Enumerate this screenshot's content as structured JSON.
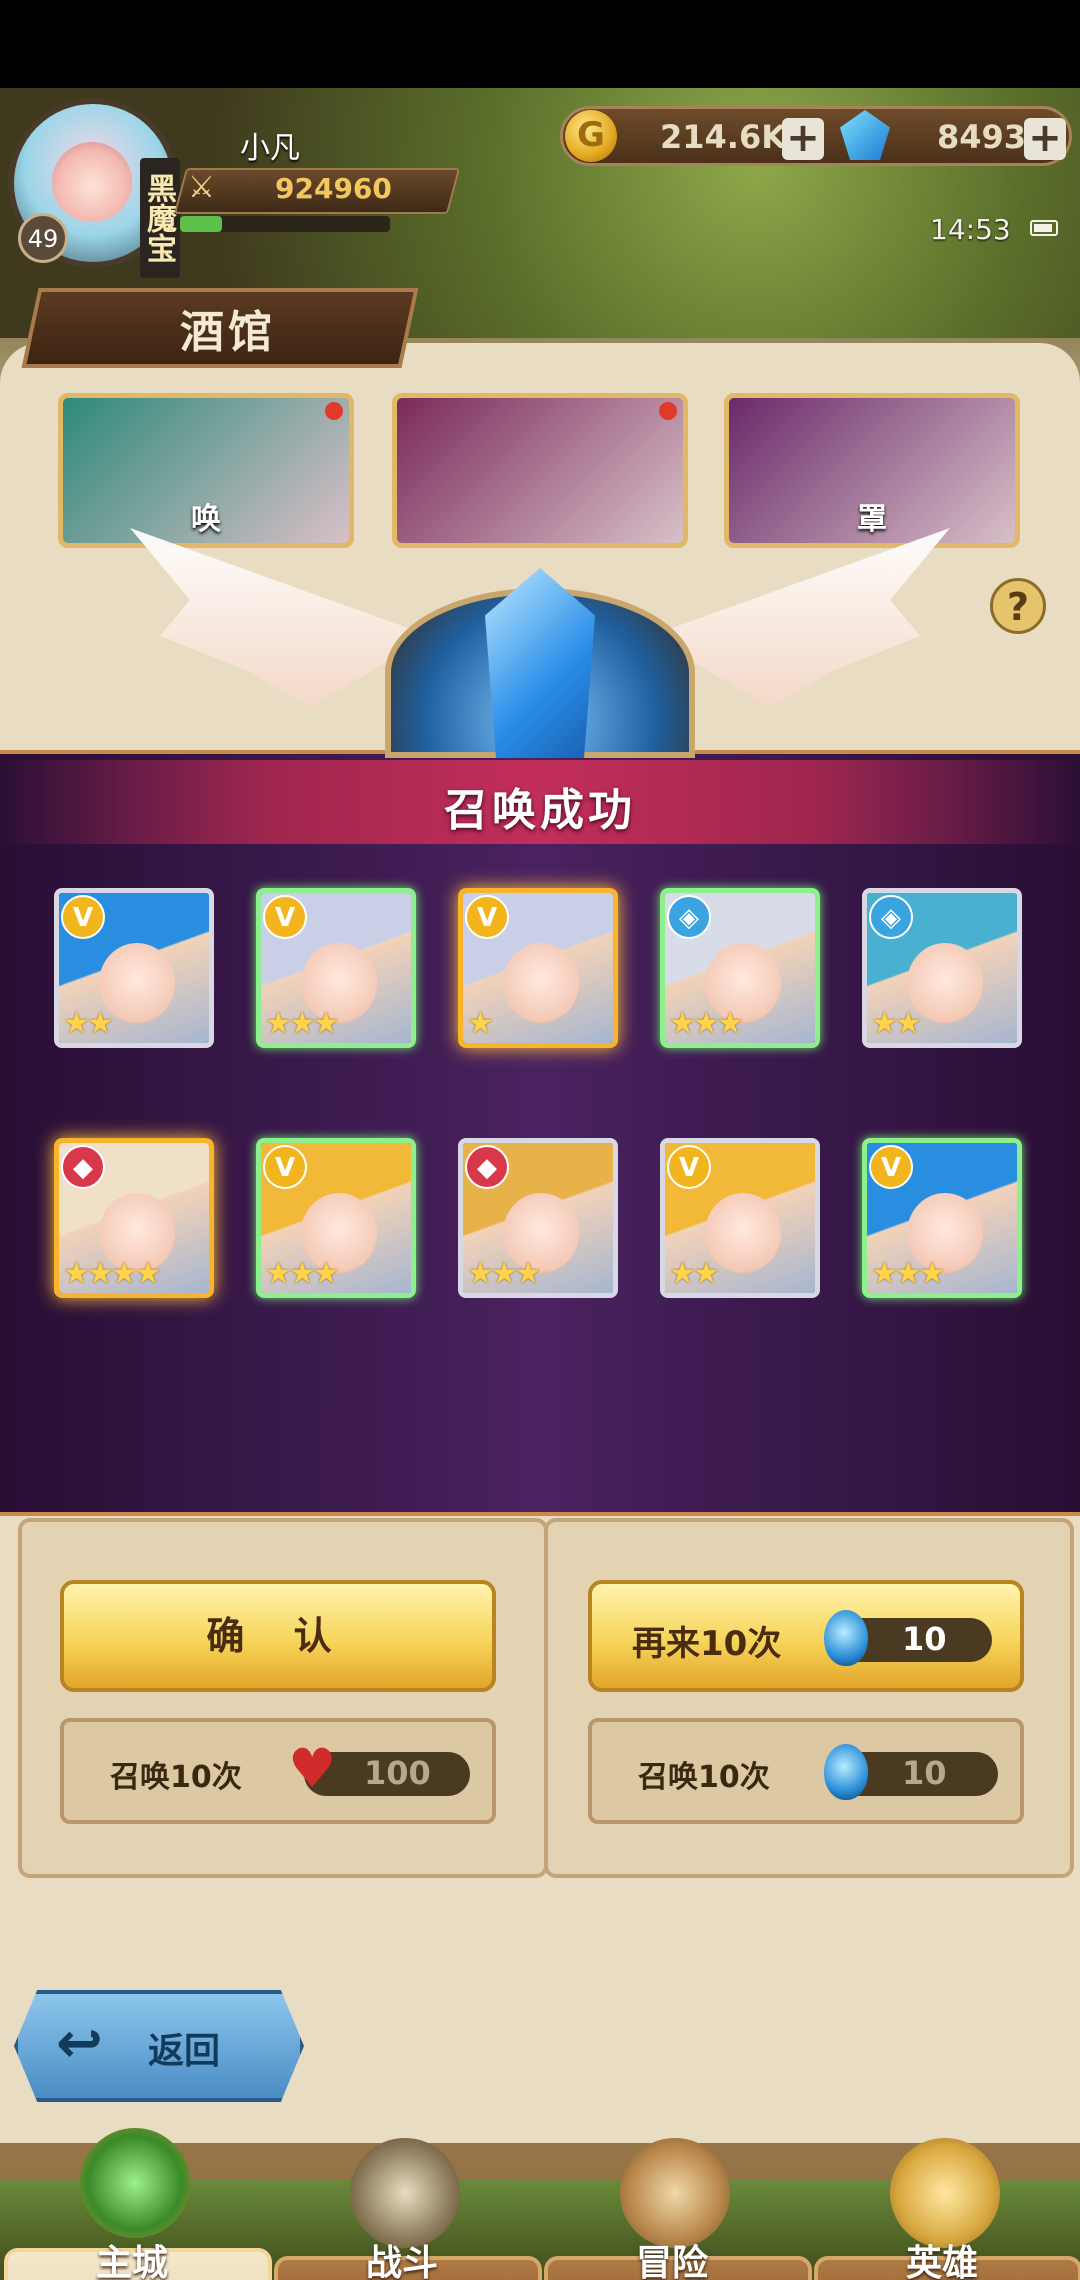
{
  "player": {
    "name": "小凡",
    "level": "49",
    "vip_label": "黑魔宝",
    "power": "924960",
    "exp_fraction": 0.2
  },
  "resources": {
    "gold": "214.6K",
    "gems": "8493",
    "plus": "+"
  },
  "status": {
    "time": "14:53"
  },
  "page": {
    "title": "酒馆",
    "help": "?"
  },
  "banners": [
    {
      "label": "唤",
      "color": "#2e8a7a"
    },
    {
      "label": "",
      "color": "#7a2a5a"
    },
    {
      "label": "罩",
      "color": "#6a2a6a"
    }
  ],
  "overlay": {
    "title": "召唤成功"
  },
  "heroes": [
    {
      "badge": "V",
      "badge_type": "v",
      "stars": "★★",
      "frame": "white",
      "hair": "#2a8ee0"
    },
    {
      "badge": "V",
      "badge_type": "v",
      "stars": "★★★",
      "frame": "green",
      "hair": "#c9cfe6"
    },
    {
      "badge": "V",
      "badge_type": "v",
      "stars": "★",
      "frame": "gold",
      "hair": "#c9cfe6"
    },
    {
      "badge": "◈",
      "badge_type": "d",
      "stars": "★★★",
      "frame": "green",
      "hair": "#d8dce8"
    },
    {
      "badge": "◈",
      "badge_type": "d",
      "stars": "★★",
      "frame": "white",
      "hair": "#4ab0d0"
    },
    {
      "badge": "◆",
      "badge_type": "r",
      "stars": "★★★★",
      "frame": "gold",
      "hair": "#f0e0c8"
    },
    {
      "badge": "V",
      "badge_type": "v",
      "stars": "★★★",
      "frame": "green",
      "hair": "#f2b838"
    },
    {
      "badge": "◆",
      "badge_type": "r",
      "stars": "★★★",
      "frame": "white",
      "hair": "#e8b24a"
    },
    {
      "badge": "V",
      "badge_type": "v",
      "stars": "★★",
      "frame": "white",
      "hair": "#f2b838"
    },
    {
      "badge": "V",
      "badge_type": "v",
      "stars": "★★★",
      "frame": "green",
      "hair": "#2a8ee0"
    }
  ],
  "summon": {
    "confirm_label": "确 认",
    "again_label": "再来10次",
    "again_cost": "10",
    "left_row_label": "召唤10次",
    "left_row_cost": "100",
    "right_row_label": "召唤10次",
    "right_row_cost": "10"
  },
  "back": {
    "label": "返回"
  },
  "nav": [
    {
      "label": "主城",
      "active": true
    },
    {
      "label": "战斗",
      "active": false
    },
    {
      "label": "冒险",
      "active": false
    },
    {
      "label": "英雄",
      "active": false
    }
  ]
}
